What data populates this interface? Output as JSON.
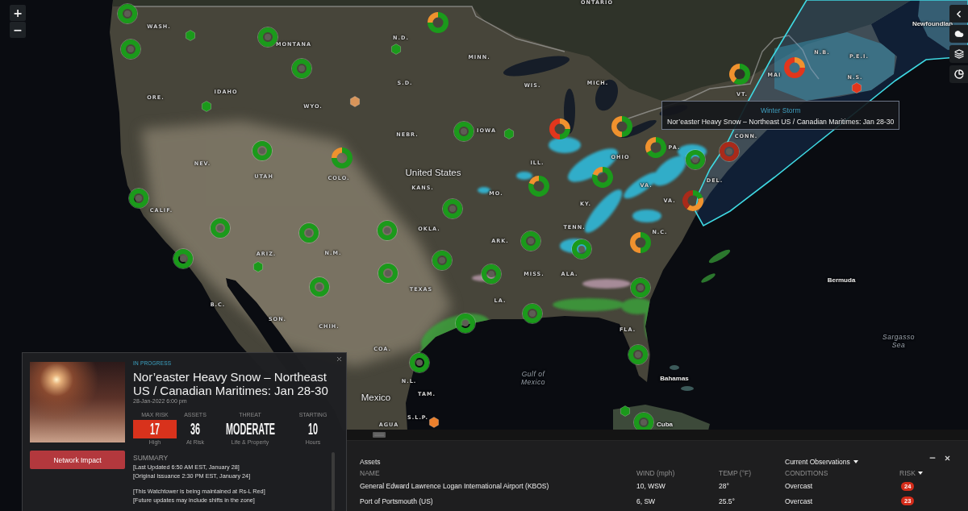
{
  "zoom_controls": [
    "+",
    "−"
  ],
  "map": {
    "labels": [
      {
        "text": "ONTARIO",
        "kind": "region"
      },
      {
        "text": "WASH.",
        "kind": "region"
      },
      {
        "text": "N.D.",
        "kind": "region"
      },
      {
        "text": "MONTANA",
        "kind": "region"
      },
      {
        "text": "MINN.",
        "kind": "region"
      },
      {
        "text": "N.B.",
        "kind": "region"
      },
      {
        "text": "P.E.I.",
        "kind": "region"
      },
      {
        "text": "MAI",
        "kind": "region"
      },
      {
        "text": "N.S.",
        "kind": "region"
      },
      {
        "text": "S.D.",
        "kind": "region"
      },
      {
        "text": "MICH.",
        "kind": "region"
      },
      {
        "text": "WIS.",
        "kind": "region"
      },
      {
        "text": "IDAHO",
        "kind": "region"
      },
      {
        "text": "VT.",
        "kind": "region"
      },
      {
        "text": "ORE.",
        "kind": "region"
      },
      {
        "text": "WYO.",
        "kind": "region"
      },
      {
        "text": "NEBR.",
        "kind": "region"
      },
      {
        "text": "IOWA",
        "kind": "region"
      },
      {
        "text": "CONN.",
        "kind": "region"
      },
      {
        "text": "PA.",
        "kind": "region"
      },
      {
        "text": "OHIO",
        "kind": "region"
      },
      {
        "text": "ILL.",
        "kind": "region"
      },
      {
        "text": "NEV.",
        "kind": "region"
      },
      {
        "text": "United States",
        "kind": "country"
      },
      {
        "text": "UTAH",
        "kind": "region"
      },
      {
        "text": "COLO.",
        "kind": "region"
      },
      {
        "text": "DEL.",
        "kind": "region"
      },
      {
        "text": "VA.",
        "kind": "region"
      },
      {
        "text": "KANS.",
        "kind": "region"
      },
      {
        "text": "MO.",
        "kind": "region"
      },
      {
        "text": "VA.",
        "kind": "region"
      },
      {
        "text": "KY.",
        "kind": "region"
      },
      {
        "text": "CALIF.",
        "kind": "region"
      },
      {
        "text": "TENN.",
        "kind": "region"
      },
      {
        "text": "OKLA.",
        "kind": "region"
      },
      {
        "text": "N.C.",
        "kind": "region"
      },
      {
        "text": "ARK.",
        "kind": "region"
      },
      {
        "text": "ARIZ.",
        "kind": "region"
      },
      {
        "text": "N.M.",
        "kind": "region"
      },
      {
        "text": "MISS.",
        "kind": "region"
      },
      {
        "text": "ALA.",
        "kind": "region"
      },
      {
        "text": "Bermuda",
        "kind": "place"
      },
      {
        "text": "TEXAS",
        "kind": "region"
      },
      {
        "text": "LA.",
        "kind": "region"
      },
      {
        "text": "B.C.",
        "kind": "region"
      },
      {
        "text": "SON.",
        "kind": "region"
      },
      {
        "text": "CHIH.",
        "kind": "region"
      },
      {
        "text": "FLA.",
        "kind": "region"
      },
      {
        "text": "Sargasso Sea",
        "kind": "water"
      },
      {
        "text": "COA.",
        "kind": "region"
      },
      {
        "text": "Gulf of Mexico",
        "kind": "water"
      },
      {
        "text": "Bahamas",
        "kind": "place"
      },
      {
        "text": "N.L.",
        "kind": "region"
      },
      {
        "text": "TAM.",
        "kind": "region"
      },
      {
        "text": "Mexico",
        "kind": "country"
      },
      {
        "text": "S.L.P.",
        "kind": "region"
      },
      {
        "text": "AGUA",
        "kind": "region"
      },
      {
        "text": "Cuba",
        "kind": "place"
      },
      {
        "text": "Newfoundlan",
        "kind": "place"
      }
    ],
    "markers": [
      {
        "kind": "ring",
        "color": "#1b9a1b"
      },
      {
        "kind": "donut",
        "segments": [
          {
            "color": "#1b9a1b"
          },
          {
            "color": "#1b9a1b"
          },
          {
            "color": "#1b9a1b"
          },
          {
            "color": "#f0922e"
          }
        ]
      },
      {
        "kind": "hexagon",
        "color": "#1b9a1b"
      },
      {
        "kind": "ring",
        "color": "#1b9a1b"
      },
      {
        "kind": "ring",
        "color": "#1b9a1b"
      },
      {
        "kind": "hexagon",
        "color": "#1b9a1b"
      },
      {
        "kind": "donut",
        "segments": [
          {
            "color": "#f0922e"
          },
          {
            "color": "#e2361c"
          },
          {
            "color": "#e2361c"
          },
          {
            "color": "#e2361c"
          }
        ]
      },
      {
        "kind": "ring",
        "color": "#1b9a1b"
      },
      {
        "kind": "donut",
        "segments": [
          {
            "color": "#1b9a1b"
          },
          {
            "color": "#1b9a1b"
          },
          {
            "color": "#1b9a1b"
          },
          {
            "color": "#f0922e"
          },
          {
            "color": "#f0922e"
          }
        ]
      },
      {
        "kind": "hexagon",
        "color": "#e2361c"
      },
      {
        "kind": "hexagon",
        "color": "#d9955a"
      },
      {
        "kind": "hexagon",
        "color": "#1b9a1b"
      },
      {
        "kind": "donut",
        "segments": [
          {
            "color": "#f0922e"
          },
          {
            "color": "#1b9a1b"
          },
          {
            "color": "#e2361c"
          },
          {
            "color": "#e2361c"
          }
        ]
      },
      {
        "kind": "donut",
        "segments": [
          {
            "color": "#1b9a1b"
          },
          {
            "color": "#f0922e"
          }
        ]
      },
      {
        "kind": "ring",
        "color": "#1b9a1b"
      },
      {
        "kind": "hexagon",
        "color": "#1b9a1b"
      },
      {
        "kind": "donut",
        "segments": [
          {
            "color": "#1b9a1b"
          },
          {
            "color": "#1b9a1b"
          },
          {
            "color": "#f0922e"
          }
        ]
      },
      {
        "kind": "ring",
        "color": "#a92a1a"
      },
      {
        "kind": "ring",
        "color": "#1b9a1b"
      },
      {
        "kind": "donut",
        "segments": [
          {
            "color": "#1b9a1b"
          },
          {
            "color": "#1b9a1b"
          },
          {
            "color": "#1b9a1b"
          },
          {
            "color": "#f0922e"
          }
        ]
      },
      {
        "kind": "ring",
        "color": "#1b9a1b"
      },
      {
        "kind": "donut",
        "segments": [
          {
            "color": "#1b9a1b"
          },
          {
            "color": "#1b9a1b"
          },
          {
            "color": "#1b9a1b"
          },
          {
            "color": "#1b9a1b"
          },
          {
            "color": "#f0922e"
          }
        ]
      },
      {
        "kind": "donut",
        "segments": [
          {
            "color": "#1b9a1b"
          },
          {
            "color": "#1b9a1b"
          },
          {
            "color": "#1b9a1b"
          },
          {
            "color": "#1b9a1b"
          },
          {
            "color": "#f0922e"
          }
        ]
      },
      {
        "kind": "ring",
        "color": "#1b9a1b"
      },
      {
        "kind": "donut",
        "segments": [
          {
            "color": "#1b9a1b"
          },
          {
            "color": "#f0922e"
          },
          {
            "color": "#f0922e"
          },
          {
            "color": "#a92a1a"
          },
          {
            "color": "#a92a1a"
          }
        ]
      },
      {
        "kind": "ring",
        "color": "#1b9a1b"
      },
      {
        "kind": "ring",
        "color": "#1b9a1b"
      },
      {
        "kind": "ring",
        "color": "#1b9a1b"
      },
      {
        "kind": "ring",
        "color": "#1b9a1b"
      },
      {
        "kind": "ring",
        "color": "#1b9a1b"
      },
      {
        "kind": "donut",
        "segments": [
          {
            "color": "#1b9a1b"
          },
          {
            "color": "#f0922e"
          }
        ]
      },
      {
        "kind": "ring",
        "color": "#1b9a1b"
      },
      {
        "kind": "ring",
        "color": "#1b9a1b"
      },
      {
        "kind": "ring",
        "color": "#1b9a1b"
      },
      {
        "kind": "hexagon",
        "color": "#1b9a1b"
      },
      {
        "kind": "ring",
        "color": "#1b9a1b"
      },
      {
        "kind": "ring",
        "color": "#1b9a1b"
      },
      {
        "kind": "ring",
        "color": "#1b9a1b"
      },
      {
        "kind": "ring",
        "color": "#1b9a1b"
      },
      {
        "kind": "ring",
        "color": "#1b9a1b"
      },
      {
        "kind": "ring",
        "color": "#1b9a1b"
      },
      {
        "kind": "ring",
        "color": "#1b9a1b"
      },
      {
        "kind": "ring",
        "color": "#1b9a1b"
      },
      {
        "kind": "hexagon",
        "color": "#1b9a1b"
      },
      {
        "kind": "hexagon",
        "color": "#ea7f2c"
      },
      {
        "kind": "ring",
        "color": "#1b9a1b"
      }
    ]
  },
  "tooltip": {
    "category": "Winter Storm",
    "title": "Nor’easter Heavy Snow – Northeast US / Canadian Maritimes: Jan 28-30"
  },
  "event_card": {
    "status": "IN PROGRESS",
    "title": "Nor’easter Heavy Snow – Northeast US / Canadian Maritimes: Jan 28-30",
    "date": "28-Jan-2022 6:00 pm",
    "stats": [
      {
        "label": "MAX RISK",
        "value": "17",
        "caption": "High",
        "kind": "badge"
      },
      {
        "label": "ASSETS",
        "value": "36",
        "caption": "At Risk",
        "kind": "plain"
      },
      {
        "label": "THREAT",
        "value": "MODERATE",
        "caption": "Life & Property",
        "kind": "plain"
      },
      {
        "label": "STARTING",
        "value": "10",
        "caption": "Hours",
        "kind": "plain"
      }
    ],
    "summary_heading": "SUMMARY",
    "summary": [
      {
        "lines": [
          "[Last Updated 6:50 AM EST, January 28]",
          "[Original Issuance 2:30 PM EST, January 24]"
        ]
      },
      {
        "lines": [
          "[This Watchtower is being maintained at Rs-L Red]",
          "[Future updates may include shifts in the zone]"
        ]
      }
    ],
    "action": "Network Impact"
  },
  "assets_panel": {
    "title": "Assets",
    "view": "Current Observations",
    "columns": [
      {
        "label": "NAME",
        "sorted": false
      },
      {
        "label": "WIND (mph)",
        "sorted": false
      },
      {
        "label": "TEMP (°F)",
        "sorted": false
      },
      {
        "label": "CONDITIONS",
        "sorted": false
      },
      {
        "label": "RISK",
        "sorted": true
      }
    ],
    "rows": [
      {
        "name": "General Edward Lawrence Logan International Airport (KBOS)",
        "wind": "10, WSW",
        "temp": "28°",
        "conditions": "Overcast",
        "risk": "24"
      },
      {
        "name": "Port of Portsmouth (US)",
        "wind": "6, SW",
        "temp": "25.5°",
        "conditions": "Overcast",
        "risk": "23"
      }
    ]
  }
}
